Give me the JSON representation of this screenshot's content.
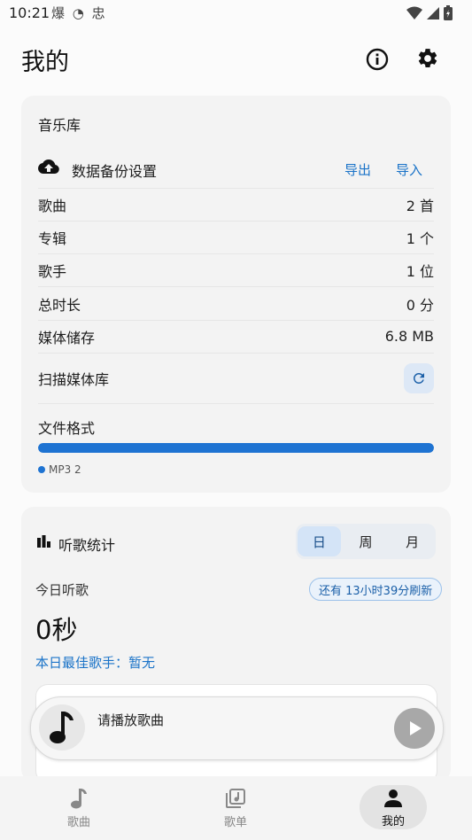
{
  "status_bar": {
    "time": "10:21",
    "app_icons": "爆 ◔ 忠"
  },
  "header": {
    "title": "我的"
  },
  "library": {
    "title": "音乐库",
    "backup": {
      "label": "数据备份设置",
      "export_label": "导出",
      "import_label": "导入"
    },
    "stats": [
      {
        "label": "歌曲",
        "value": "2 首"
      },
      {
        "label": "专辑",
        "value": "1 个"
      },
      {
        "label": "歌手",
        "value": "1 位"
      },
      {
        "label": "总时长",
        "value": "0 分"
      },
      {
        "label": "媒体储存",
        "value": "6.8 MB"
      }
    ],
    "scan_label": "扫描媒体库",
    "format": {
      "title": "文件格式",
      "items": [
        {
          "label": "MP3 2",
          "fraction": 1.0,
          "color": "#1e73d2"
        }
      ]
    }
  },
  "listening": {
    "title": "听歌统计",
    "periods": [
      "日",
      "周",
      "月"
    ],
    "active_period": "日",
    "today_label": "今日听歌",
    "refresh_badge": "还有 13小时39分刷新",
    "duration": "0秒",
    "best_artist": "本日最佳歌手：暂无"
  },
  "player": {
    "prompt": "请播放歌曲"
  },
  "nav": {
    "items": [
      {
        "label": "歌曲",
        "icon": "music-note-icon"
      },
      {
        "label": "歌单",
        "icon": "playlist-icon"
      },
      {
        "label": "我的",
        "icon": "person-icon"
      }
    ],
    "active": "我的"
  },
  "colors": {
    "accent": "#1e73d2",
    "link": "#1a73c8"
  }
}
